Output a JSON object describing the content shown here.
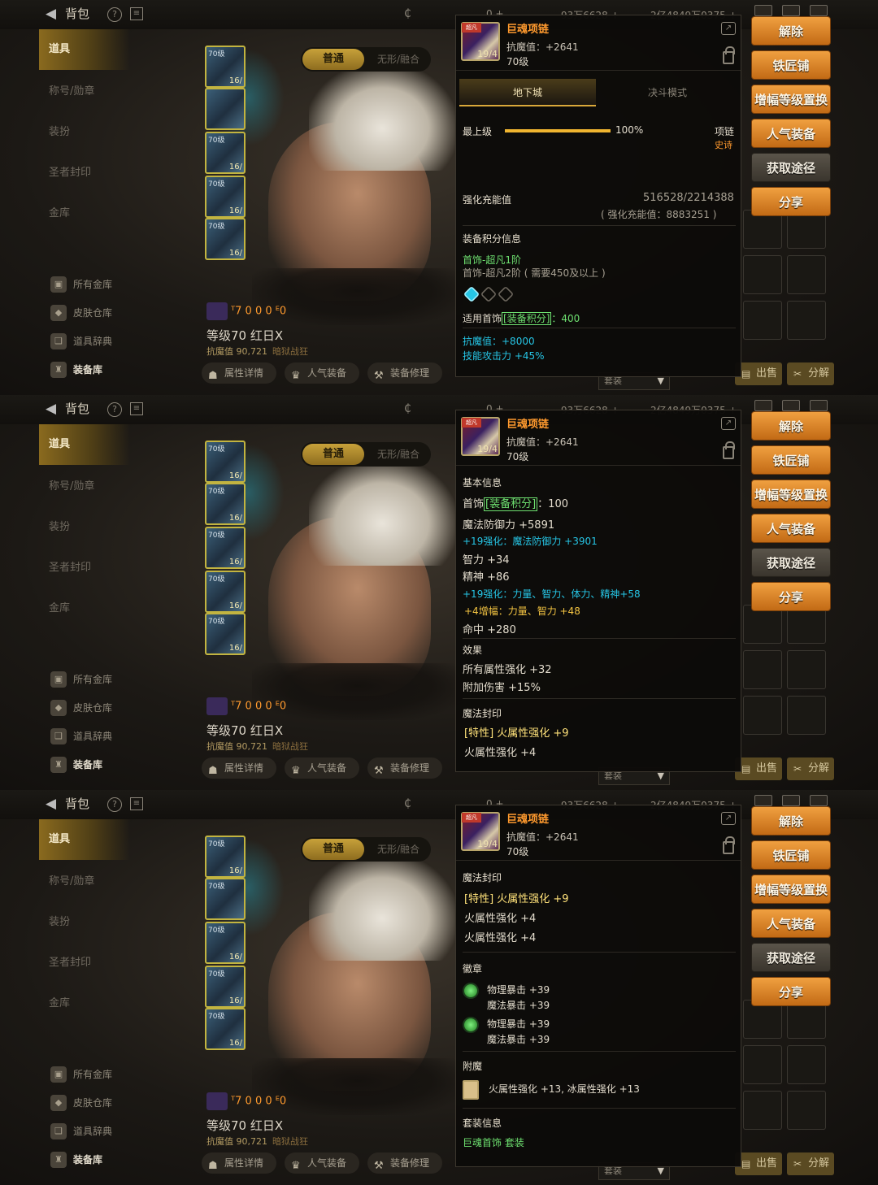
{
  "header": {
    "back_label": "背包",
    "currency_a": "0 +",
    "currency_b": "93万6628 +",
    "currency_c": "2亿4849万0375 +"
  },
  "sidebar": {
    "items": [
      {
        "label": "道具",
        "active": true
      },
      {
        "label": "称号/勋章",
        "active": false
      },
      {
        "label": "装扮",
        "active": false
      },
      {
        "label": "圣者封印",
        "active": false
      },
      {
        "label": "金库",
        "active": false
      }
    ],
    "subs": [
      {
        "label": "所有金库"
      },
      {
        "label": "皮肤仓库"
      },
      {
        "label": "道具辞典"
      },
      {
        "label": "装备库"
      }
    ]
  },
  "mode": {
    "normal": "普通",
    "fusion": "无形/融合"
  },
  "character": {
    "stats_icons": "ᵀ7  0  0  0  ᴱ0",
    "level_text": "等级70 红日X",
    "resist_text": "抗魔值 90,721",
    "guild": "暗狱战狂",
    "buttons": [
      "属性详情",
      "人气装备",
      "装备修理"
    ]
  },
  "slots": [
    {
      "level": "70级",
      "count": "16/"
    },
    {
      "level": "70级",
      "count": "16/"
    },
    {
      "level": "70级",
      "count": "16/"
    },
    {
      "level": "70级",
      "count": "16/"
    },
    {
      "level": "70级",
      "count": "16/"
    }
  ],
  "right_buttons": [
    {
      "label": "解除",
      "style": "orange"
    },
    {
      "label": "铁匠铺",
      "style": "orange"
    },
    {
      "label": "增幅等级置换",
      "style": "orange"
    },
    {
      "label": "人气装备",
      "style": "orange"
    },
    {
      "label": "获取途径",
      "style": "gray"
    },
    {
      "label": "分享",
      "style": "orange"
    }
  ],
  "bottom_right": {
    "sell": "出售",
    "dismantle": "分解",
    "set_dropdown": "套装"
  },
  "item": {
    "name": "巨魂项链",
    "resist": "抗魔值：+2641",
    "level": "70级",
    "icon_count": "19/4",
    "icon_tag": "超凡"
  },
  "panel1": {
    "tab_dungeon": "地下城",
    "tab_pvp": "决斗模式",
    "grade_label": "最上级",
    "grade_percent": "100%",
    "grade_fraction": 1.0,
    "slot_type": "项链",
    "rarity": "史诗",
    "charge_label": "强化充能值",
    "charge_value": "516528/2214388",
    "charge_total": "( 强化充能值：8883251 )",
    "score_title": "装备积分信息",
    "tier_now": "首饰-超凡1阶",
    "tier_next": "首饰-超凡2阶 ( 需要450及以上 )",
    "score_prefix": "适用首饰",
    "score_tag": "[装备积分]",
    "score_value": "：400",
    "bonus_resist": "抗魔值：+8000",
    "bonus_skill": "技能攻击力 +45%"
  },
  "panel2": {
    "basic_title": "基本信息",
    "score_prefix": "首饰",
    "score_tag": "[装备积分]",
    "score_value": "：100",
    "mdef": "魔法防御力 +5891",
    "enh1": "+19强化：魔法防御力 +3901",
    "int": "智力 +34",
    "spirit": "精神 +86",
    "enh2": "+19强化：力量、智力、体力、精神+58",
    "amp": "+4增幅：力量、智力 +48",
    "hit": "命中 +280",
    "effect_title": "效果",
    "eff1": "所有属性强化 +32",
    "eff2": "附加伤害 +15%",
    "seal_title": "魔法封印",
    "seal1": "[特性] 火属性强化 +9",
    "seal2": "火属性强化 +4"
  },
  "panel3": {
    "seal_title": "魔法封印",
    "seal1": "[特性] 火属性强化 +9",
    "seal2": "火属性强化 +4",
    "seal3": "火属性强化 +4",
    "emblem_title": "徽章",
    "emblem1a": "物理暴击 +39",
    "emblem1b": "魔法暴击 +39",
    "emblem2a": "物理暴击 +39",
    "emblem2b": "魔法暴击 +39",
    "enchant_title": "附魔",
    "enchant": "火属性强化 +13, 冰属性强化 +13",
    "set_title": "套装信息",
    "set_name": "巨魂首饰 套装"
  }
}
